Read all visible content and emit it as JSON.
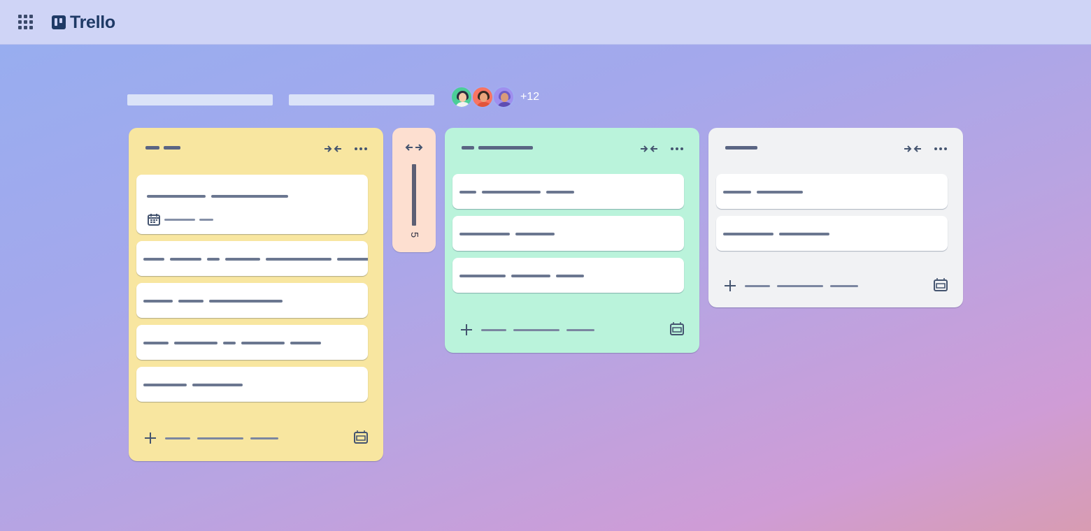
{
  "app": {
    "name": "Trello"
  },
  "board": {
    "members_extra": "+12"
  },
  "lists": [
    {
      "id": "yellow",
      "color": "#f8e6a0",
      "cards": 5
    },
    {
      "id": "collapsed",
      "color": "#fddfd0",
      "card_count": "5"
    },
    {
      "id": "green",
      "color": "#baf3db",
      "cards": 3
    },
    {
      "id": "gray",
      "color": "#f1f2f4",
      "cards": 2
    }
  ],
  "icons": {
    "apps": "grid-icon",
    "collapse": "collapse-arrows-icon",
    "expand": "expand-arrows-icon",
    "menu": "ellipsis-icon",
    "add": "plus-icon",
    "template": "template-icon",
    "date": "calendar-icon"
  },
  "colors": {
    "topbar": "#cfd4f6",
    "logo": "#1f3a66",
    "text_placeholder": "#5a6583"
  }
}
